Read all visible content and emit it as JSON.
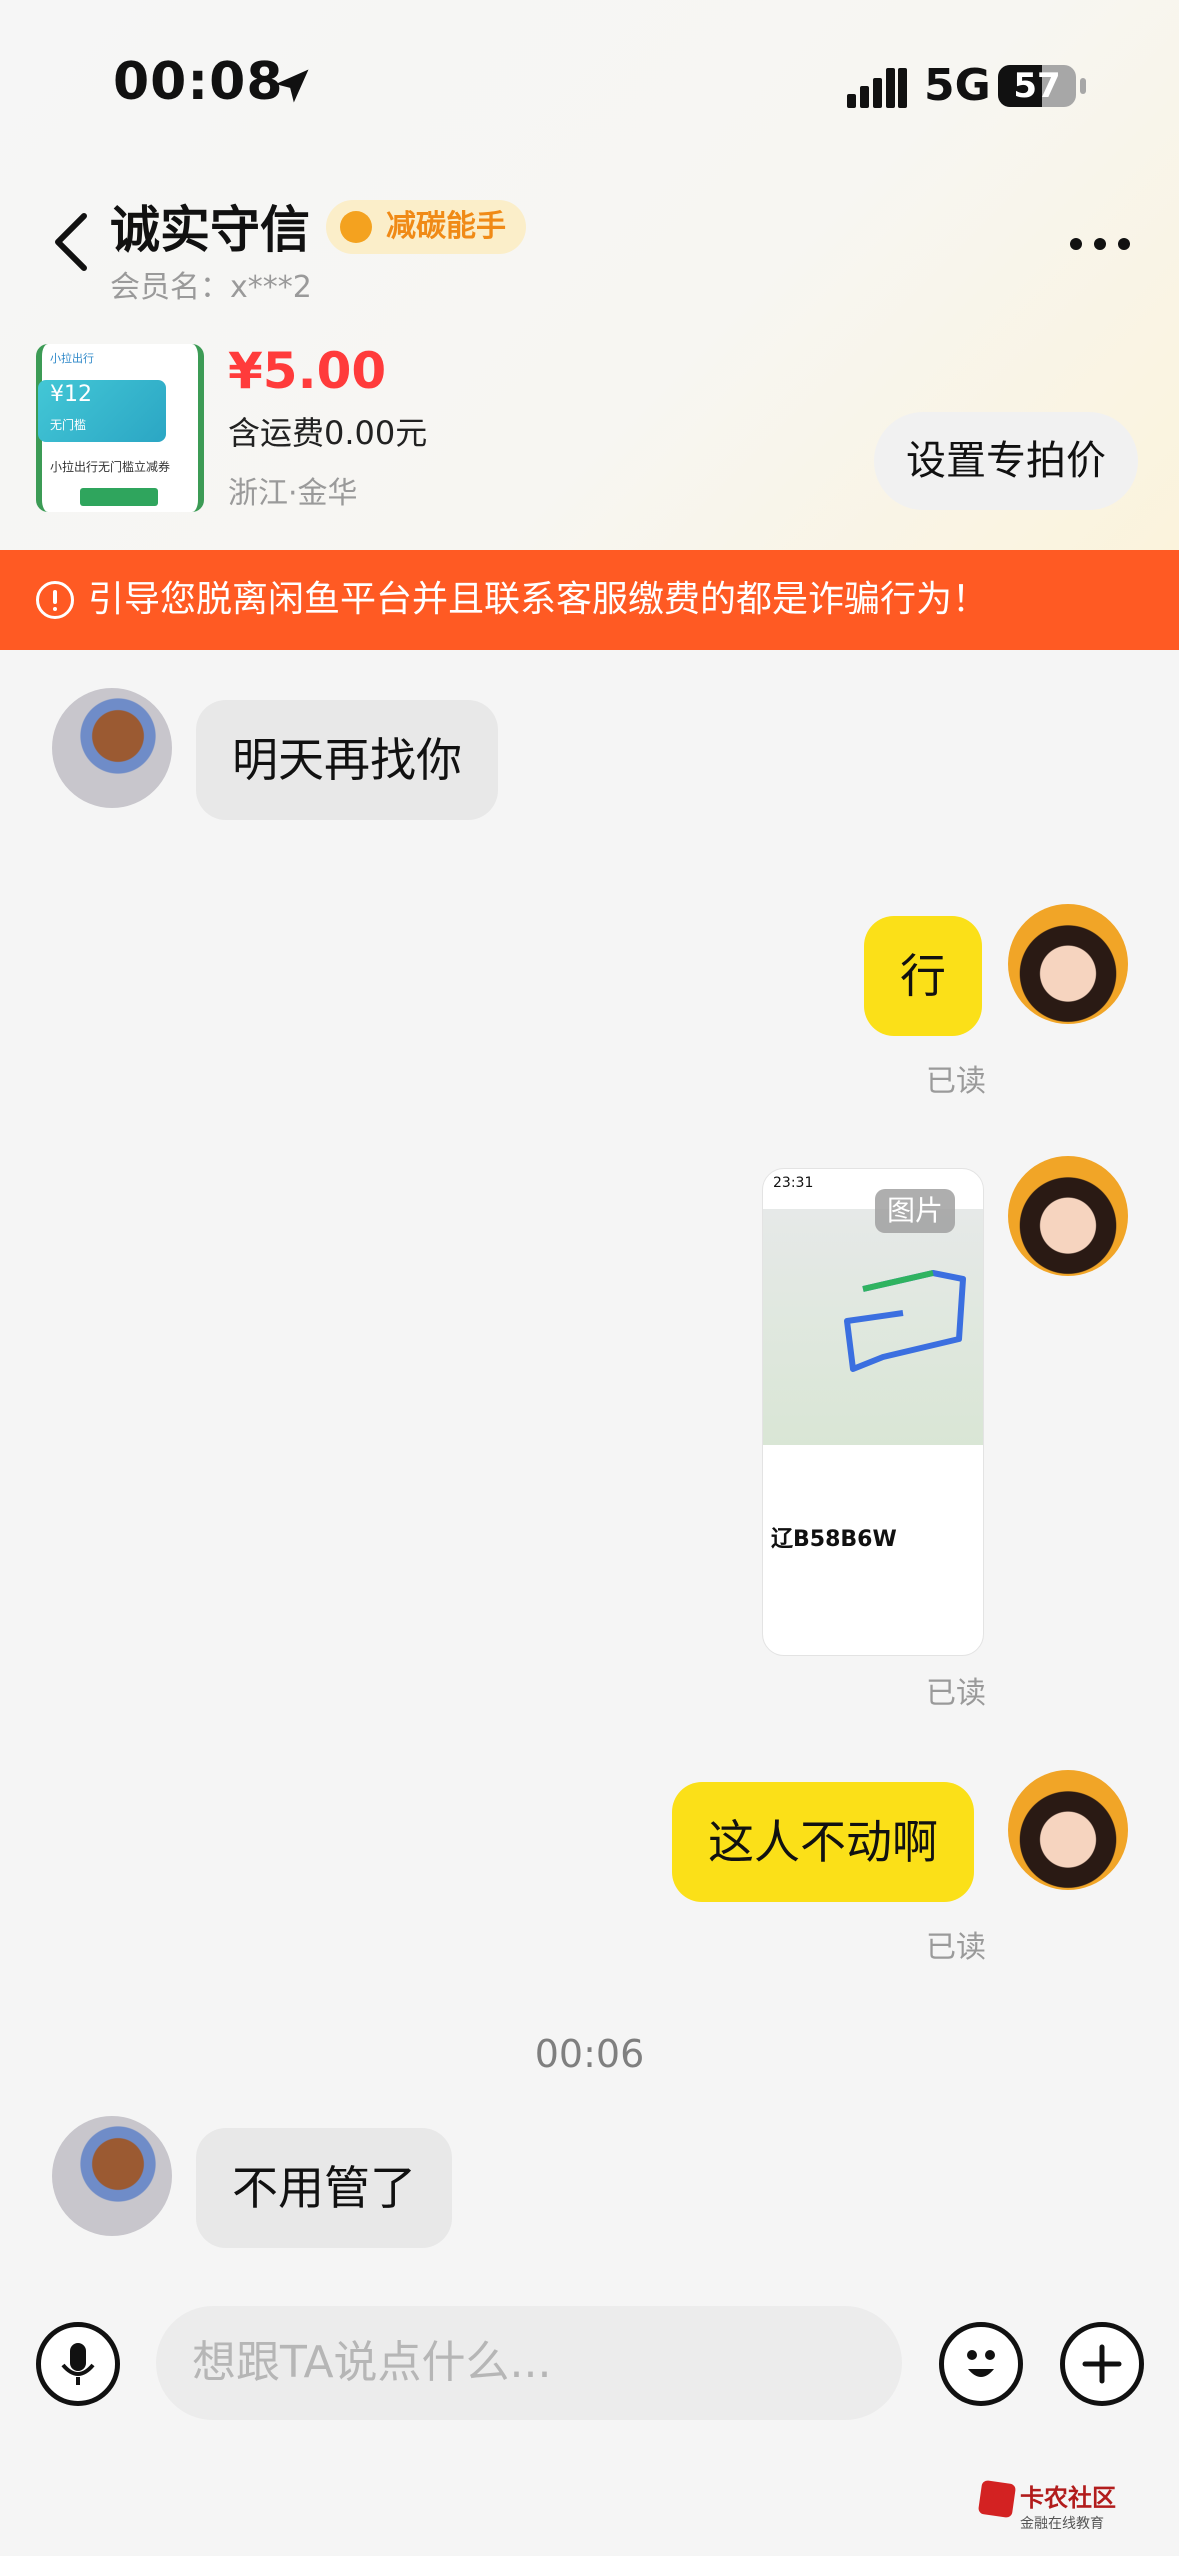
{
  "status_bar": {
    "time": "00:08",
    "network": "5G",
    "battery": "57",
    "battery_level": 0.57
  },
  "header": {
    "shop_name": "诚实守信",
    "badge": "减碳能手",
    "member": "会员名：x***2"
  },
  "product": {
    "price": "¥5.00",
    "shipping": "含运费0.00元",
    "location": "浙江·金华",
    "special_button": "设置专拍价",
    "thumb_logo": "小拉出行",
    "thumb_ticket": "¥12",
    "thumb_ticket_sub": "无门槛",
    "thumb_caption": "小拉出行无门槛立减券"
  },
  "warning": "引导您脱离闲鱼平台并且联系客服缴费的都是诈骗行为！",
  "messages": {
    "m1": "明天再找你",
    "m2": "行",
    "m3_label": "图片",
    "m3_plate": "辽B58B6W",
    "m3_time": "23:31",
    "m4": "这人不动啊",
    "m5": "不用管了",
    "read": "已读",
    "time_sep": "00:06"
  },
  "input": {
    "placeholder": "想跟TA说点什么..."
  },
  "watermark": {
    "title": "卡农社区",
    "sub": "金融在线教育"
  },
  "colors": {
    "warning": "#ff5a23",
    "outgoing": "#fbe018",
    "incoming": "#e8e8e8",
    "price": "#ff3b3b"
  }
}
